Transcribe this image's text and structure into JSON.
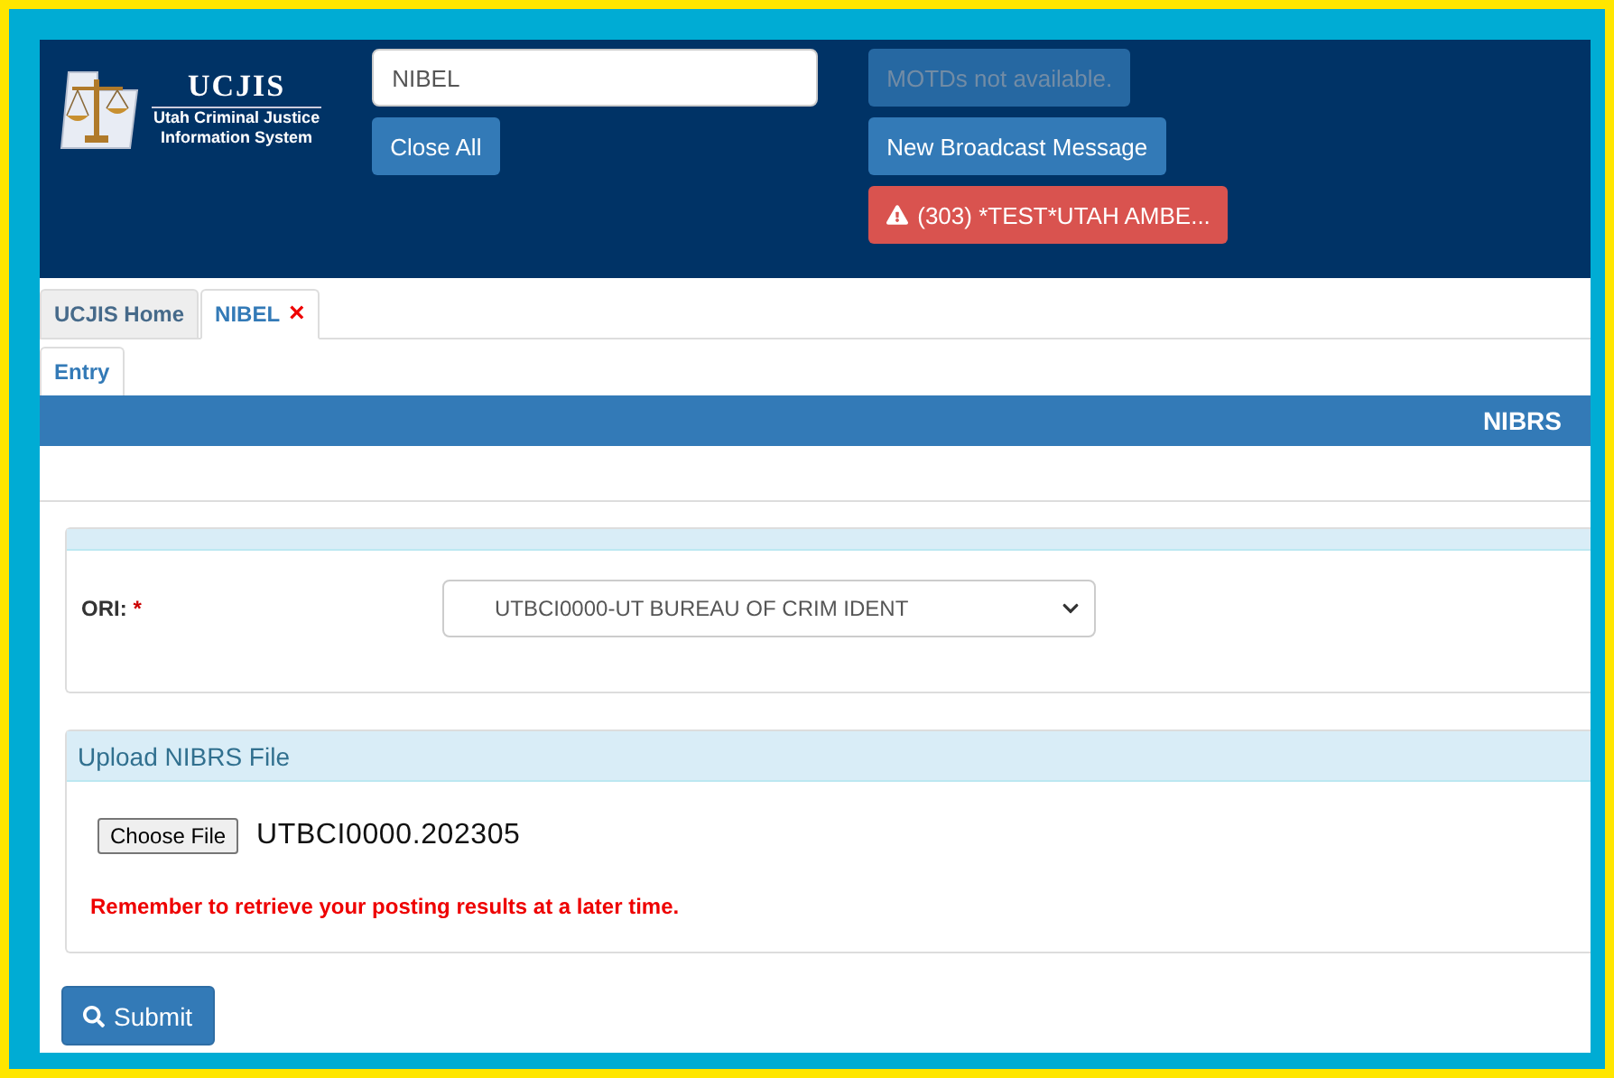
{
  "header": {
    "logo": {
      "title": "UCJIS",
      "subtitle_lines": [
        "Utah Criminal Justice",
        "Information System"
      ]
    },
    "search": {
      "value": "NIBEL"
    },
    "close_all": "Close All",
    "motd": "MOTDs not available.",
    "broadcast": "New Broadcast Message",
    "alert": "(303) *TEST*UTAH AMBE..."
  },
  "tabs": [
    {
      "label": "UCJIS Home",
      "selected": false,
      "closable": false
    },
    {
      "label": "NIBEL",
      "selected": true,
      "closable": true
    }
  ],
  "close_mark": "×",
  "subtabs": [
    {
      "label": "Entry",
      "selected": true
    }
  ],
  "section_title": "NIBRS",
  "ori": {
    "label": "ORI:",
    "required_mark": "*",
    "value": "UTBCI0000-UT BUREAU OF CRIM IDENT"
  },
  "upload": {
    "title": "Upload NIBRS File",
    "button": "Choose File",
    "file": "UTBCI0000.202305",
    "notice": "Remember to retrieve your posting results at a later time."
  },
  "submit": "Submit"
}
